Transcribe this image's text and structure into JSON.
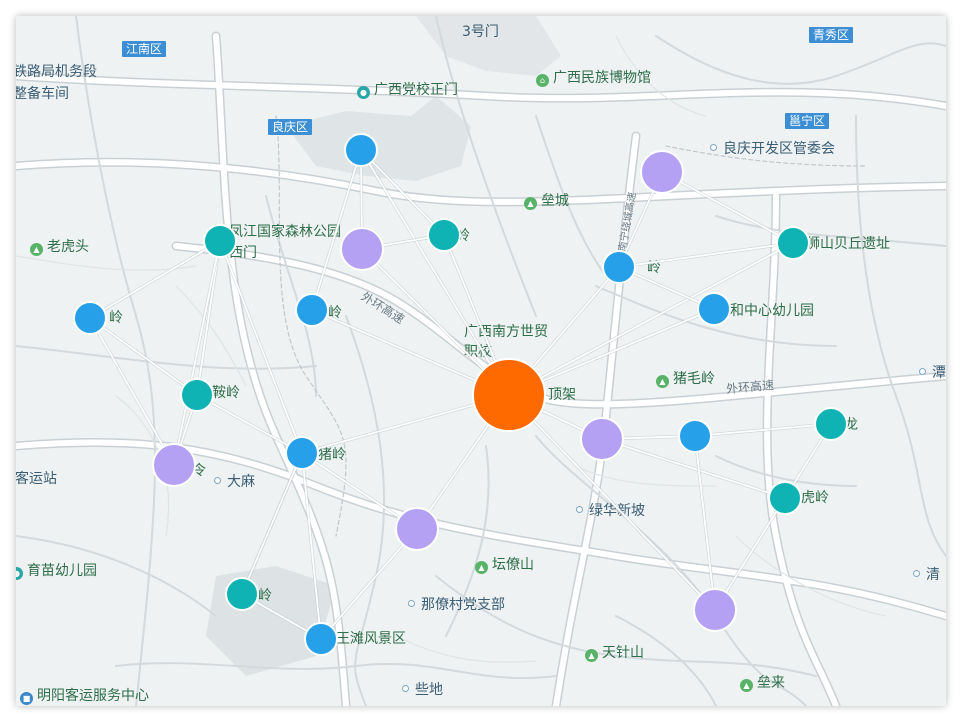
{
  "colors": {
    "center": "#ff6a00",
    "blue": "#27a0ea",
    "teal": "#10b3b3",
    "purple": "#b4a1f4",
    "edge": "#ffffff"
  },
  "districts": [
    "江南区",
    "良庆区",
    "青秀区",
    "邕宁区"
  ],
  "places": [
    "3号门",
    "广西民族博物馆",
    "广西党校正门",
    "铁路局机务段",
    "整备车间",
    "良庆开发区管委会",
    "垒城",
    "凤江国家森林公园",
    "西门",
    "老虎头",
    "岭",
    "岭",
    "狮山贝丘遗址",
    "和中心幼儿园",
    "广西南方世贸",
    "职校",
    "猪毛岭",
    "顶架",
    "鞍岭",
    "猪岭",
    "大麻",
    "客运站",
    "绿华新坡",
    "坛僚山",
    "那僚村党支部",
    "育苗幼儿园",
    "王滩风景区",
    "天针山",
    "垒来",
    "些地",
    "明阳客运服务中心",
    "潭",
    "清",
    "虎岭",
    "龙",
    "令",
    "岭",
    "岭",
    "岭"
  ],
  "road_labels": [
    "外环高速",
    "外环高速",
    "南宁绕城高速"
  ],
  "network": {
    "nodes": [
      {
        "id": "center",
        "group": "center"
      },
      {
        "id": "n1",
        "group": "blue"
      },
      {
        "id": "n2",
        "group": "teal"
      },
      {
        "id": "n3",
        "group": "purple"
      },
      {
        "id": "n4",
        "group": "blue"
      },
      {
        "id": "n5",
        "group": "purple"
      },
      {
        "id": "n6",
        "group": "teal"
      },
      {
        "id": "n7",
        "group": "blue"
      },
      {
        "id": "n8",
        "group": "blue"
      },
      {
        "id": "n9",
        "group": "teal"
      },
      {
        "id": "n10",
        "group": "blue"
      },
      {
        "id": "n11",
        "group": "teal"
      },
      {
        "id": "n12",
        "group": "blue"
      },
      {
        "id": "n13",
        "group": "purple"
      },
      {
        "id": "n14",
        "group": "blue"
      },
      {
        "id": "n15",
        "group": "purple"
      },
      {
        "id": "n16",
        "group": "teal"
      },
      {
        "id": "n17",
        "group": "blue"
      },
      {
        "id": "n18",
        "group": "purple"
      },
      {
        "id": "n19",
        "group": "blue"
      },
      {
        "id": "n20",
        "group": "teal"
      },
      {
        "id": "n21",
        "group": "teal"
      },
      {
        "id": "n22",
        "group": "purple"
      }
    ],
    "edges": [
      [
        "center",
        "n1"
      ],
      [
        "center",
        "n2"
      ],
      [
        "center",
        "n3"
      ],
      [
        "center",
        "n7"
      ],
      [
        "center",
        "n5"
      ],
      [
        "center",
        "n6"
      ],
      [
        "center",
        "n12"
      ],
      [
        "center",
        "n15"
      ],
      [
        "center",
        "n18"
      ],
      [
        "center",
        "n22"
      ],
      [
        "n1",
        "n3"
      ],
      [
        "n1",
        "n4"
      ],
      [
        "n1",
        "n2"
      ],
      [
        "n3",
        "n2"
      ],
      [
        "n7",
        "n5"
      ],
      [
        "n7",
        "n6"
      ],
      [
        "n7",
        "n8"
      ],
      [
        "n7",
        "n9"
      ],
      [
        "n9",
        "n11"
      ],
      [
        "n9",
        "n10"
      ],
      [
        "n9",
        "n12"
      ],
      [
        "n10",
        "n11"
      ],
      [
        "n10",
        "n13"
      ],
      [
        "n11",
        "n13"
      ],
      [
        "n11",
        "n12"
      ],
      [
        "n12",
        "n14"
      ],
      [
        "n12",
        "n16"
      ],
      [
        "n12",
        "n17"
      ],
      [
        "n12",
        "n15"
      ],
      [
        "n16",
        "n17"
      ],
      [
        "n15",
        "n17"
      ],
      [
        "n18",
        "n19"
      ],
      [
        "n18",
        "n21"
      ],
      [
        "n19",
        "n20"
      ],
      [
        "n19",
        "n22"
      ],
      [
        "n21",
        "n20"
      ],
      [
        "n21",
        "n22"
      ]
    ]
  }
}
